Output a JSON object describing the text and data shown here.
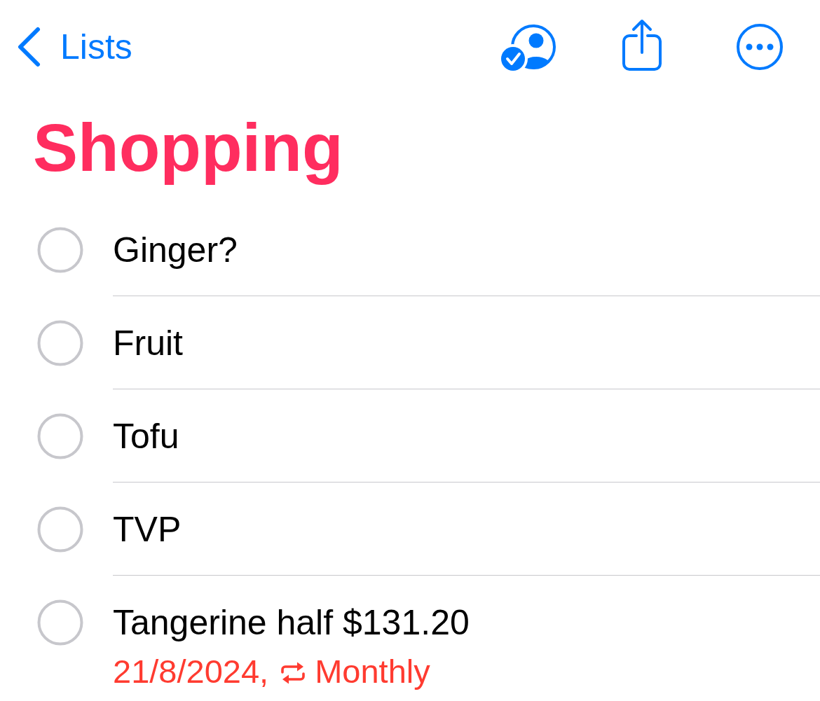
{
  "nav": {
    "back_label": "Lists"
  },
  "title": "Shopping",
  "items": [
    {
      "title": "Ginger?",
      "completed": false
    },
    {
      "title": "Fruit",
      "completed": false
    },
    {
      "title": "Tofu",
      "completed": false
    },
    {
      "title": "TVP",
      "completed": false
    },
    {
      "title": "Tangerine half $131.20",
      "completed": false,
      "due": "21/8/2024,",
      "repeat": "Monthly"
    }
  ]
}
